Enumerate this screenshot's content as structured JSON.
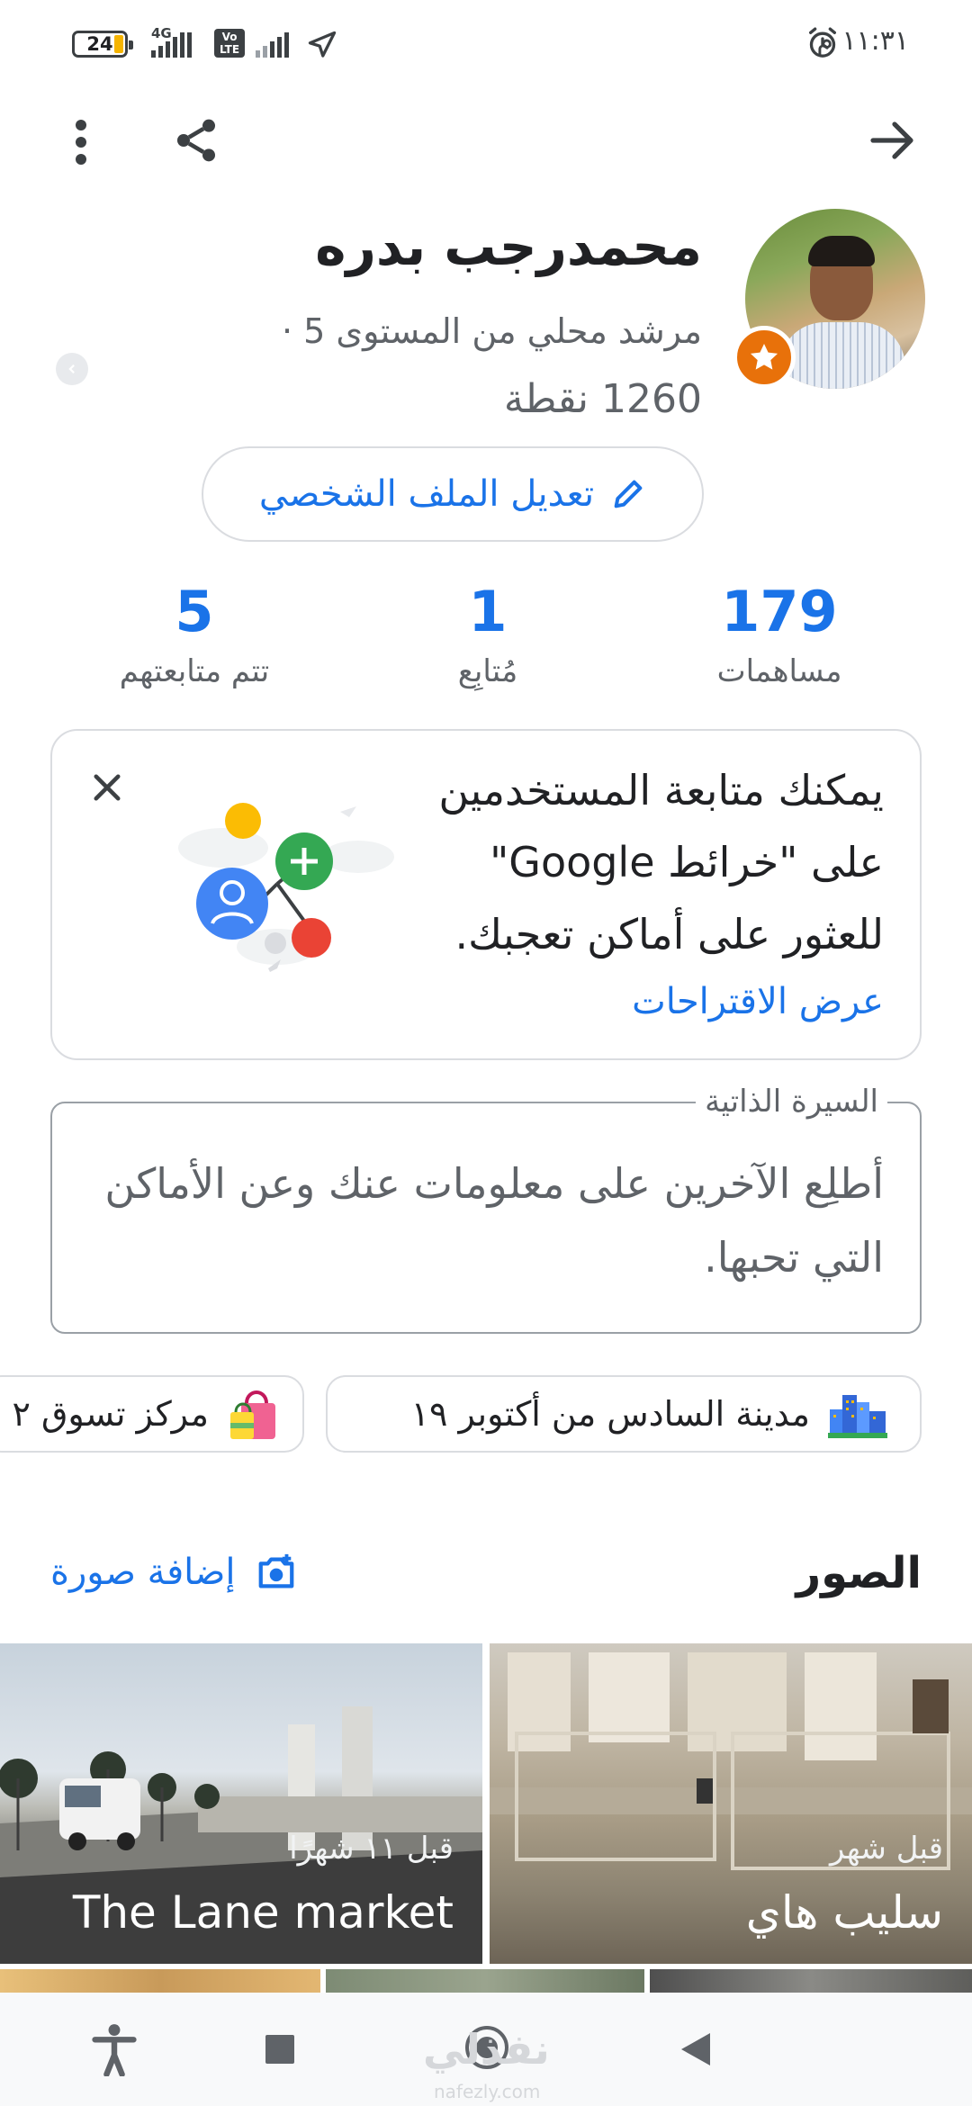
{
  "status_bar": {
    "battery": "24",
    "network": "4G",
    "volte": "Vo\nLTE",
    "time": "١١:٣١ م"
  },
  "profile": {
    "name": "محمدرجب بدره",
    "subtitle": "مرشد محلي من المستوى 5 ·",
    "points": "1260 نقطة",
    "edit_label": "تعديل الملف الشخصي"
  },
  "stats": [
    {
      "value": "179",
      "label": "مساهمات"
    },
    {
      "value": "1",
      "label": "مُتابِع"
    },
    {
      "value": "5",
      "label": "تتم متابعتهم"
    }
  ],
  "suggestion_card": {
    "text": "يمكنك متابعة المستخدمين على \"خرائط Google\" للعثور على أماكن تعجبك.",
    "link": "عرض الاقتراحات"
  },
  "bio": {
    "legend": "السيرة الذاتية",
    "placeholder": "أطلِع الآخرين على معلومات عنك وعن الأماكن التي تحبها."
  },
  "chips": [
    {
      "label": "مدينة السادس من أكتوبر ١٩",
      "icon": "city-icon"
    },
    {
      "label": "مركز تسوق ٢",
      "icon": "shopping-bag-icon"
    }
  ],
  "photos": {
    "title": "الصور",
    "add_label": "إضافة صورة",
    "items": [
      {
        "when": "قبل ١١ شهرًا",
        "title": "The Lane market"
      },
      {
        "when": "قبل شهر",
        "title": "سليب هاي"
      }
    ]
  },
  "watermark": {
    "text": "نفذلي",
    "sub": "nafezly.com"
  },
  "colors": {
    "accent": "#1a73e8",
    "badge": "#e8710a"
  }
}
